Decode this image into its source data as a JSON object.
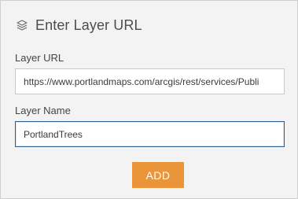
{
  "dialog": {
    "title": "Enter Layer URL",
    "icon": "layers-icon"
  },
  "form": {
    "url_label": "Layer URL",
    "url_value": "https://www.portlandmaps.com/arcgis/rest/services/Publi",
    "name_label": "Layer Name",
    "name_value": "PortlandTrees",
    "add_label": "ADD"
  },
  "colors": {
    "accent": "#ea953a",
    "focus": "#2f5d8e",
    "panel": "#f3f3f3"
  }
}
